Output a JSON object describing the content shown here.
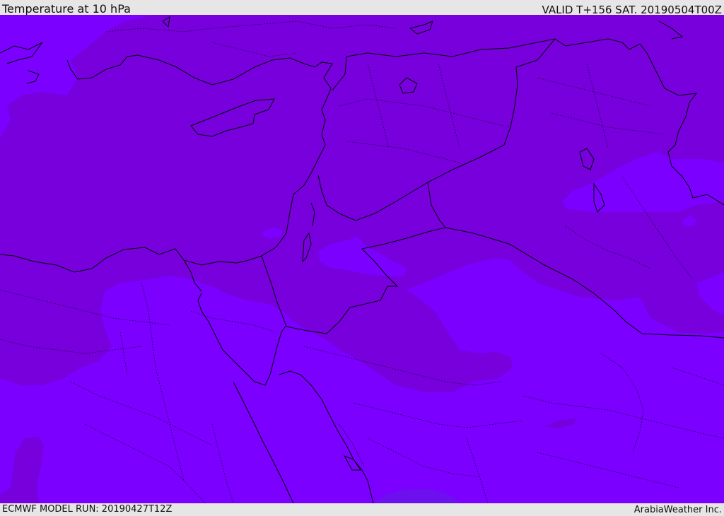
{
  "header": {
    "title": "Temperature at 10 hPa",
    "valid": "VALID T+156 SAT. 20190504T00Z"
  },
  "footer": {
    "model_run": "ECMWF MODEL RUN: 20190427T12Z",
    "credit": "ArabiaWeather Inc."
  },
  "colors": {
    "dark_band": "#7700dd",
    "light_band": "#7b00ff",
    "small_patch": "#6d10ee",
    "border_line": "#000000"
  },
  "icons": {
    "map": "weather-map"
  }
}
